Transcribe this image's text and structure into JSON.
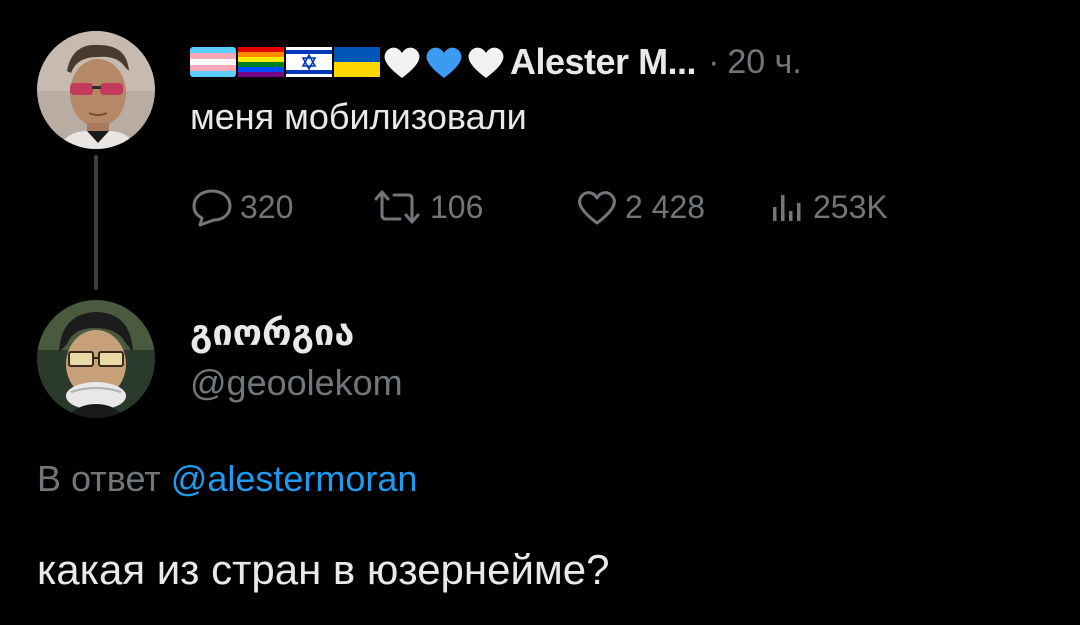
{
  "parent_tweet": {
    "display_name": "Alester M...",
    "separator": "·",
    "time": "20 ч.",
    "flag_icons": [
      "transgender-flag-icon",
      "rainbow-flag-icon",
      "israel-flag-icon",
      "ukraine-flag-icon",
      "white-heart-icon",
      "blue-heart-icon",
      "white-heart-icon"
    ],
    "text": "меня мобилизовали",
    "stats": {
      "replies": "320",
      "retweets": "106",
      "likes": "2 428",
      "views": "253K"
    }
  },
  "reply_tweet": {
    "display_name": "გიორგია",
    "handle": "@geoolekom",
    "reply_prefix": "В ответ",
    "reply_mention": "@alestermoran",
    "text": "какая из стран в юзернейме?"
  },
  "colors": {
    "background": "#000000",
    "primary_text": "#e7e9ea",
    "secondary_text": "#71767b",
    "link": "#1d9bf0",
    "thread_line": "#3a3f45"
  }
}
